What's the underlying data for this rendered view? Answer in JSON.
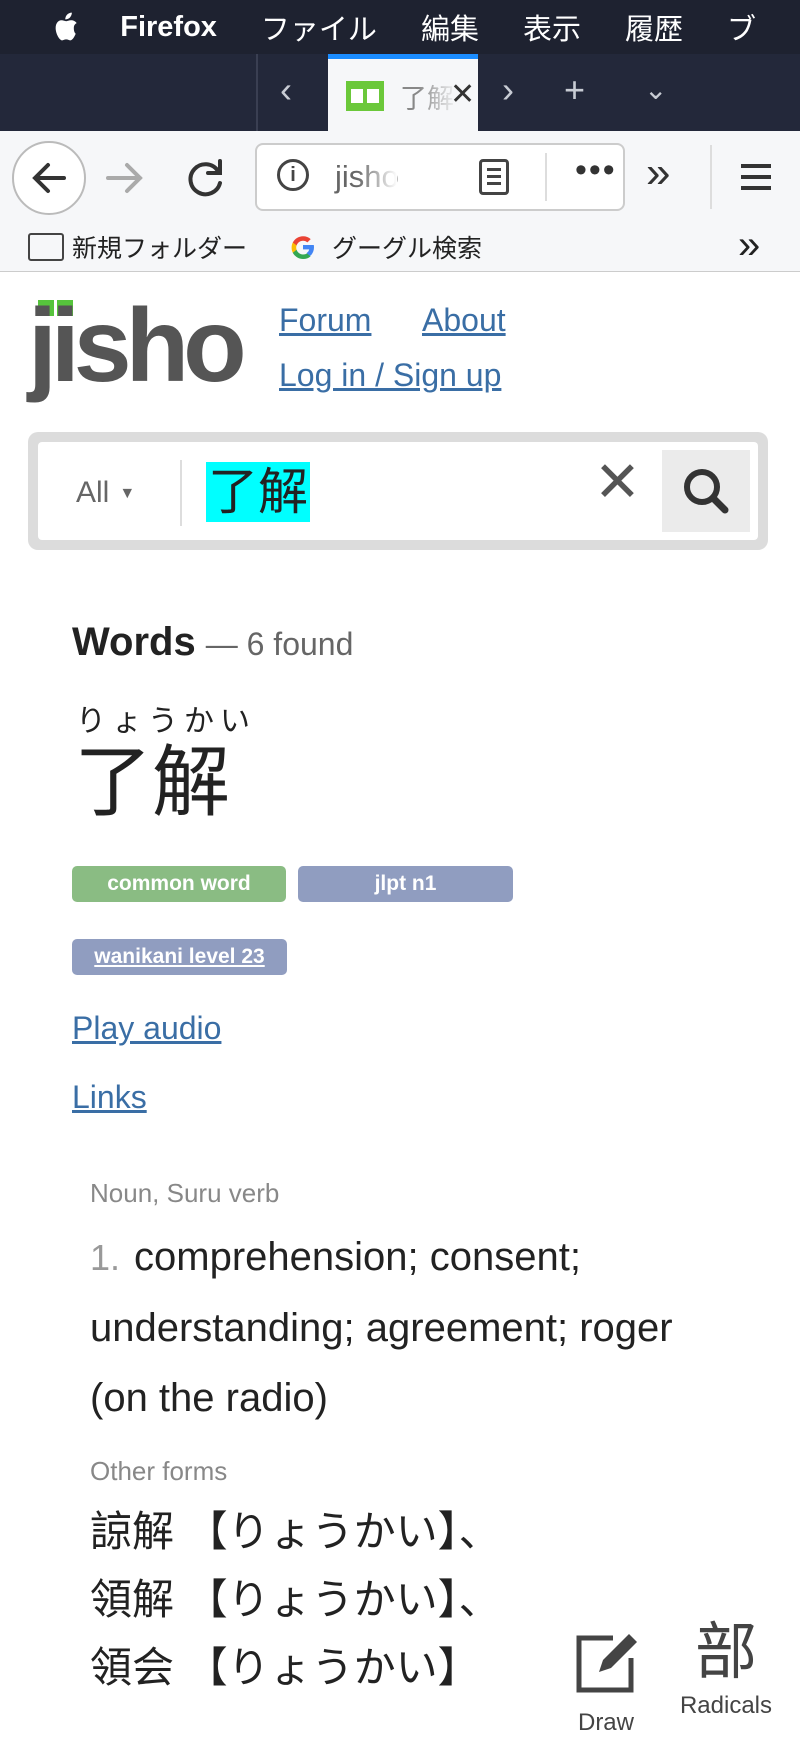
{
  "menubar": {
    "app": "Firefox",
    "items": [
      "ファイル",
      "編集",
      "表示",
      "履歴",
      "ブ"
    ]
  },
  "tab": {
    "title": "了解"
  },
  "address": {
    "url": "jisho"
  },
  "bookmarks": {
    "folder": "新規フォルダー",
    "google": "グーグル検索"
  },
  "site": {
    "logo": "jisho",
    "links": {
      "forum": "Forum",
      "about": "About",
      "login": "Log in / Sign up"
    }
  },
  "search": {
    "filter": "All",
    "query": "了解"
  },
  "results": {
    "heading": "Words",
    "count": "— 6 found",
    "furigana": "りょうかい",
    "word": "了解",
    "tags": [
      "common word",
      "jlpt n1",
      "wanikani level 23"
    ],
    "play_audio": "Play audio",
    "links": "Links",
    "part_of_speech": "Noun, Suru verb",
    "sense_number": "1.",
    "meaning": "comprehension; consent; understanding; agreement; roger (on the radio)",
    "other_forms_title": "Other forms",
    "other_forms": [
      "諒解 【りょうかい】、",
      "領解 【りょうかい】、",
      "領会 【りょうかい】"
    ]
  },
  "tools": {
    "draw": "Draw",
    "radicals_glyph": "部",
    "radicals": "Radicals"
  },
  "colors": {
    "link": "#3a6ea5",
    "tag_common": "#8abc83",
    "tag_jlpt": "#909dc0",
    "query_highlight": "#00ffff",
    "logo_green": "#56c43c"
  }
}
